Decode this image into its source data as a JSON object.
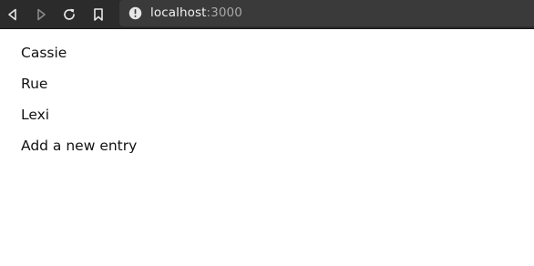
{
  "browser": {
    "url_host": "localhost",
    "url_port": ":3000",
    "icons": {
      "back": "back-arrow-icon",
      "forward": "forward-arrow-icon",
      "reload": "reload-icon",
      "bookmark": "bookmark-icon",
      "site_info": "info-icon"
    },
    "colors": {
      "toolbar": "#2b2b2b",
      "urlbar": "#3a3a3a"
    }
  },
  "entries": [
    {
      "label": "Cassie"
    },
    {
      "label": "Rue"
    },
    {
      "label": "Lexi"
    }
  ],
  "add_entry_label": "Add a new entry"
}
